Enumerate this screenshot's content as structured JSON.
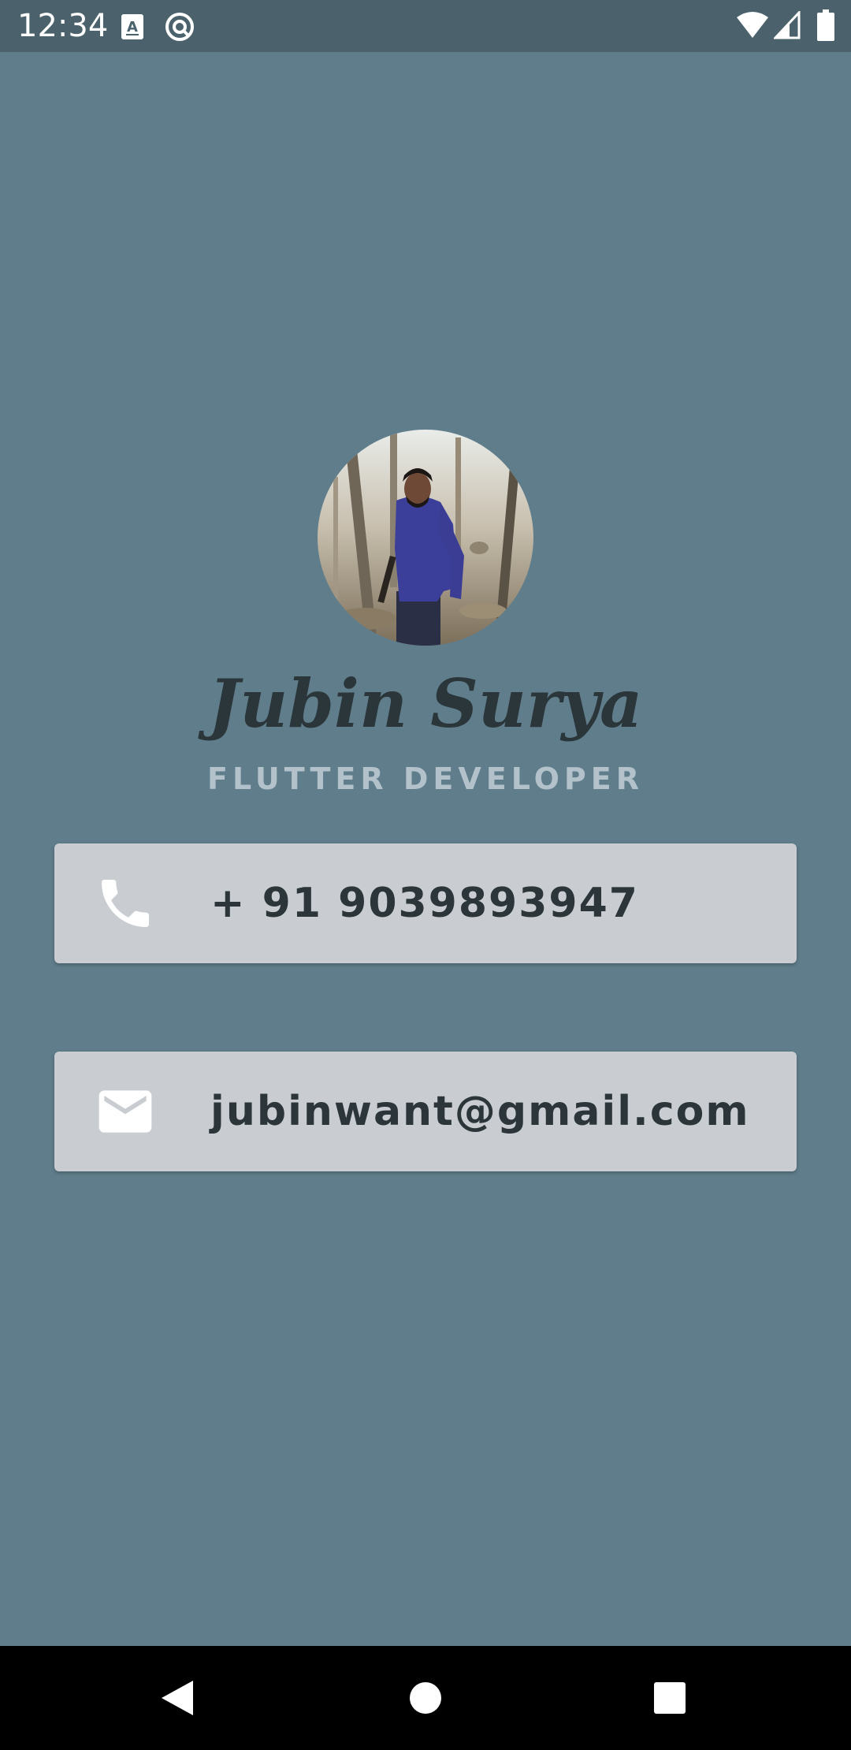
{
  "status_bar": {
    "time": "12:34",
    "left_icons": [
      "font-download-icon",
      "sync-circle-icon"
    ],
    "right_icons": [
      "wifi-icon",
      "cell-signal-icon",
      "battery-icon"
    ]
  },
  "profile": {
    "avatar_icon": "profile-photo",
    "name": "Jubin Surya",
    "title": "FLUTTER DEVELOPER"
  },
  "contacts": {
    "phone": {
      "icon": "phone-icon",
      "value": "+ 91 9039893947"
    },
    "email": {
      "icon": "mail-icon",
      "value": "jubinwant@gmail.com"
    }
  },
  "nav_bar": {
    "buttons": [
      "back-icon",
      "home-icon",
      "recents-icon"
    ]
  },
  "colors": {
    "background": "#607d8b",
    "status_bar": "#4b626d",
    "card": "#c9cdd1",
    "name_text": "#2b363b",
    "title_text": "#b3c2ca",
    "card_text": "#2b353a"
  }
}
